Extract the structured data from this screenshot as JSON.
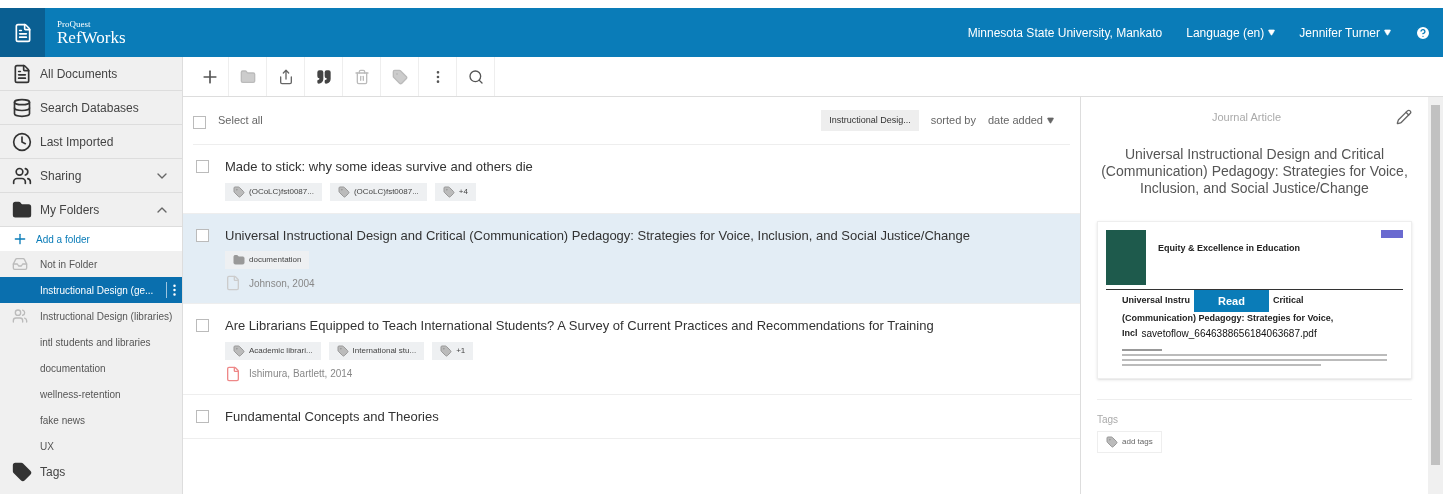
{
  "header": {
    "brand_small": "ProQuest",
    "brand": "RefWorks",
    "institution": "Minnesota State University, Mankato",
    "language": "Language (en)",
    "user": "Jennifer Turner"
  },
  "sidebar": {
    "items": [
      {
        "label": "All Documents",
        "kind": "nav"
      },
      {
        "label": "Search Databases",
        "kind": "nav"
      },
      {
        "label": "Last Imported",
        "kind": "nav"
      },
      {
        "label": "Sharing",
        "kind": "section",
        "expanded": false
      },
      {
        "label": "My Folders",
        "kind": "section",
        "expanded": true
      }
    ],
    "add_folder": "Add a folder",
    "folders": [
      {
        "label": "Not in Folder",
        "kind": "unfiled",
        "selected": false
      },
      {
        "label": "Instructional Design (ge...",
        "kind": "folder",
        "selected": true
      },
      {
        "label": "Instructional Design (libraries)",
        "kind": "shared",
        "selected": false
      },
      {
        "label": "intl students and libraries",
        "kind": "folder",
        "selected": false
      },
      {
        "label": "documentation",
        "kind": "folder",
        "selected": false
      },
      {
        "label": "wellness-retention",
        "kind": "folder",
        "selected": false
      },
      {
        "label": "fake news",
        "kind": "folder",
        "selected": false
      },
      {
        "label": "UX",
        "kind": "folder",
        "selected": false
      }
    ],
    "tags_label": "Tags"
  },
  "list": {
    "select_all": "Select all",
    "all_checked": false,
    "filter_chip": "Instructional Desig...",
    "sorted_by": "sorted by",
    "sort_value": "date added",
    "rows": [
      {
        "title": "Made to stick: why some ideas survive and others die",
        "selected": false,
        "checked": false,
        "tags": [
          {
            "kind": "tag",
            "label": "(OCoLC)fst0087..."
          },
          {
            "kind": "tag",
            "label": "(OCoLC)fst0087..."
          },
          {
            "kind": "tag",
            "label": "+4"
          }
        ]
      },
      {
        "title": "Universal Instructional Design and Critical (Communication) Pedagogy: Strategies for Voice, Inclusion, and Social Justice/Change",
        "selected": true,
        "checked": false,
        "tags": [
          {
            "kind": "folder",
            "label": "documentation"
          }
        ],
        "author": "Johnson, 2004",
        "pdf": false
      },
      {
        "title": "Are Librarians Equipped to Teach International Students? A Survey of Current Practices and Recommendations for Training",
        "selected": false,
        "checked": false,
        "tags": [
          {
            "kind": "tag",
            "label": "Academic librari..."
          },
          {
            "kind": "tag",
            "label": "International stu..."
          },
          {
            "kind": "tag",
            "label": "+1"
          }
        ],
        "author": "Ishimura, Bartlett, 2014",
        "pdf": true
      },
      {
        "title": "Fundamental Concepts and Theories",
        "selected": false,
        "checked": false,
        "tags": []
      }
    ]
  },
  "detail": {
    "type": "Journal Article",
    "title": "Universal Instructional Design and Critical (Communication) Pedagogy: Strategies for Voice, Inclusion, and Social Justice/Change",
    "preview": {
      "journal": "Equity & Excellence in Education",
      "title_start": "Universal Instru",
      "title_end": "Critical",
      "title_line2": "(Communication) Pedagogy: Strategies for Voice,",
      "title_line3": "Incl",
      "read": "Read",
      "filename": "savetoflow_6646388656184063687.pdf"
    },
    "tags_label": "Tags",
    "add_tags": "add tags"
  }
}
